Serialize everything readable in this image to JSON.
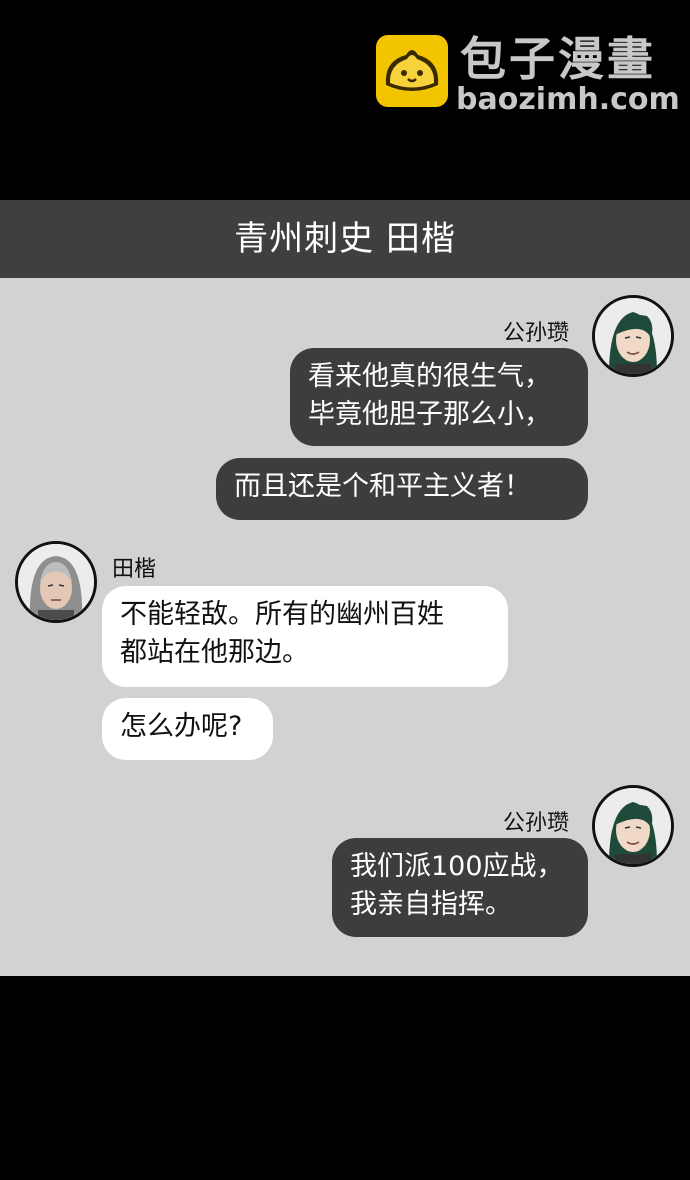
{
  "watermark": {
    "title": "包子漫畫",
    "url": "baozimh.com",
    "icon": "bun-logo-icon",
    "accent": "#f2c500"
  },
  "header": {
    "title": "青州刺史 田楷"
  },
  "colors": {
    "chat_bg": "#d2d2d2",
    "header_bg": "#3f3f3f",
    "dark_bubble": "#3d3d3d",
    "light_bubble": "#ffffff"
  },
  "messages": [
    {
      "speaker": "公孙瓒",
      "side": "right",
      "lines": [
        "看来他真的很生气，\n毕竟他胆子那么小，",
        "而且还是个和平主义者！"
      ]
    },
    {
      "speaker": "田楷",
      "side": "left",
      "lines": [
        "不能轻敌。所有的幽州百姓\n都站在他那边。",
        "怎么办呢?"
      ]
    },
    {
      "speaker": "公孙瓒",
      "side": "right",
      "lines": [
        "我们派100应战，\n我亲自指挥。"
      ]
    }
  ]
}
